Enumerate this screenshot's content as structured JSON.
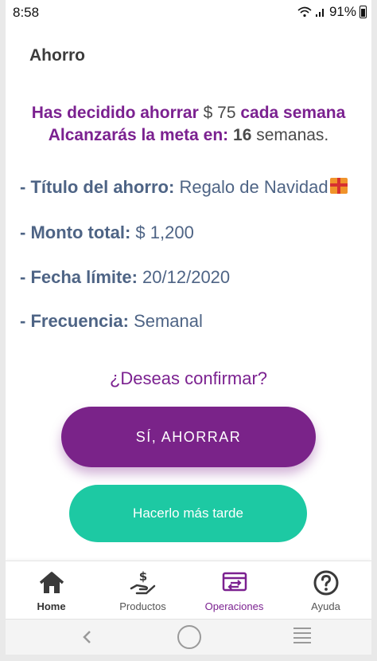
{
  "status": {
    "time": "8:58",
    "battery": "91%"
  },
  "header": {
    "title": "Ahorro"
  },
  "summary": {
    "line1_prefix": "Has decidido ahorrar",
    "amount": "$ 75",
    "line1_suffix": "cada semana",
    "line2_prefix": "Alcanzarás la meta en:",
    "weeks": "16",
    "line2_suffix": "semanas."
  },
  "details": [
    {
      "label": "- Título del ahorro:",
      "value": "Regalo de Navidad"
    },
    {
      "label": "- Monto total:",
      "value": "$ 1,200"
    },
    {
      "label": "- Fecha límite:",
      "value": "20/12/2020"
    },
    {
      "label": "- Frecuencia:",
      "value": "Semanal"
    }
  ],
  "confirm": {
    "question": "¿Deseas confirmar?",
    "primary_label": "SÍ, AHORRAR",
    "secondary_label": "Hacerlo más tarde"
  },
  "bottom_nav": [
    {
      "label": "Home",
      "icon": "home-icon"
    },
    {
      "label": "Productos",
      "icon": "hand-money-icon"
    },
    {
      "label": "Operaciones",
      "icon": "card-transfer-icon",
      "active": true
    },
    {
      "label": "Ayuda",
      "icon": "help-icon"
    }
  ],
  "colors": {
    "primary": "#7a2389",
    "secondary": "#1dc9a3",
    "detail_text": "#4e6485"
  }
}
